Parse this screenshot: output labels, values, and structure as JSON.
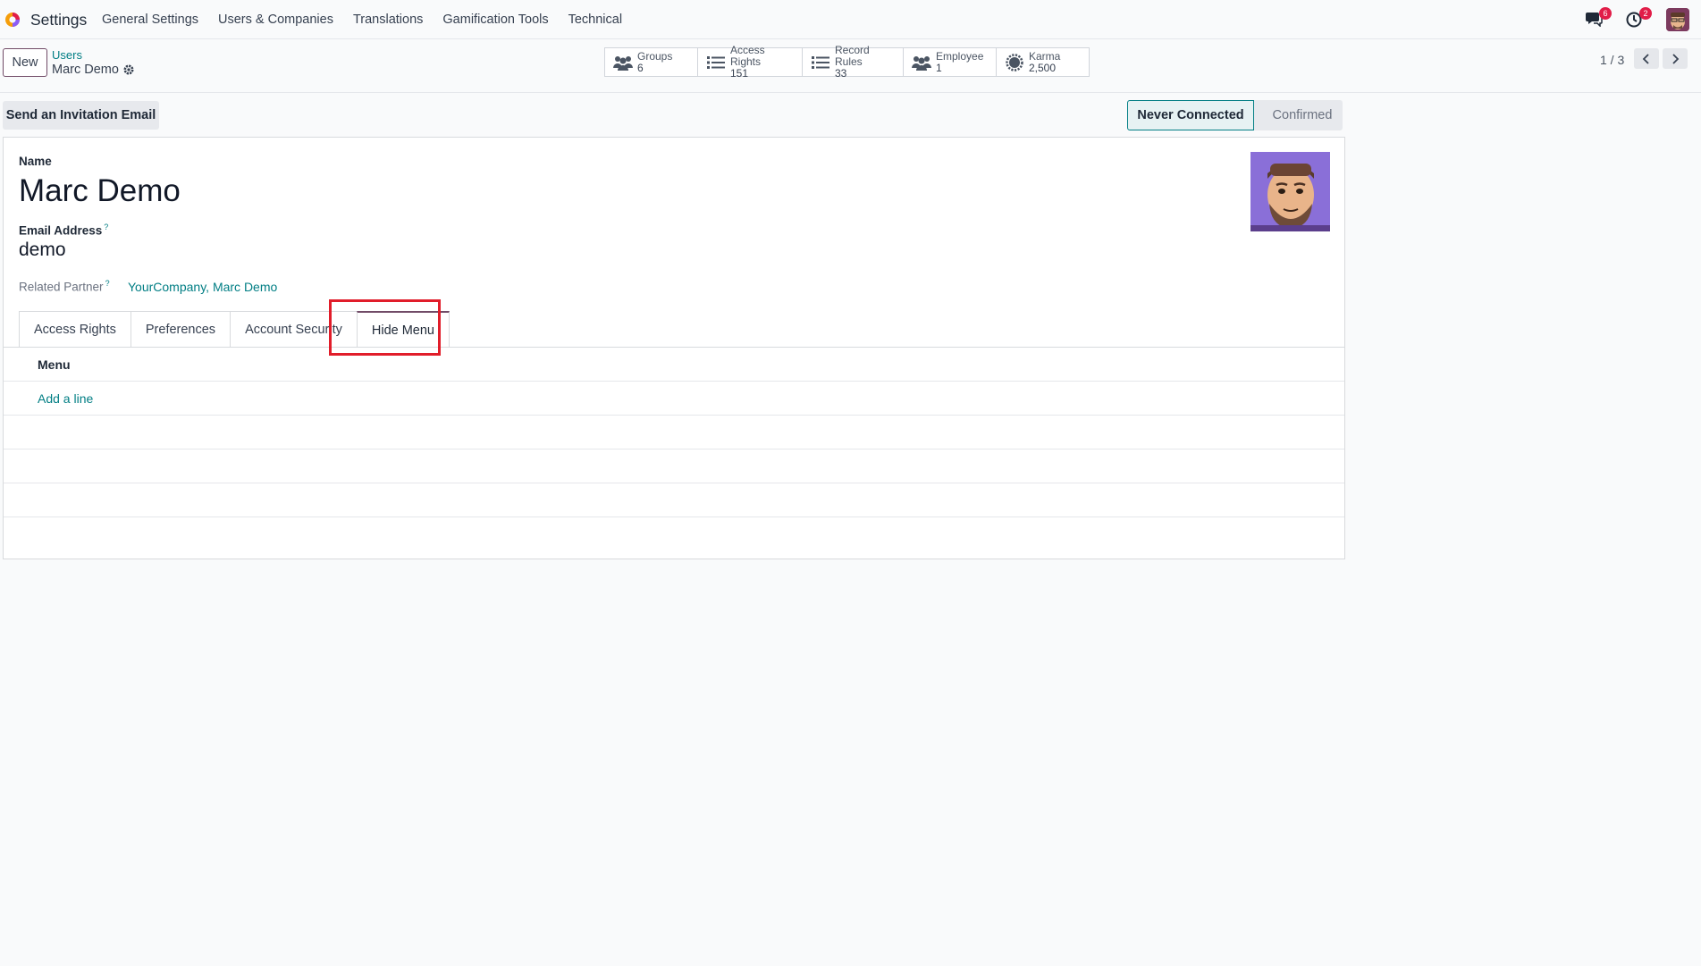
{
  "navbar": {
    "app_name": "Settings",
    "menu": [
      "General Settings",
      "Users & Companies",
      "Translations",
      "Gamification Tools",
      "Technical"
    ],
    "messages_badge": "6",
    "activities_badge": "2"
  },
  "control_panel": {
    "new_label": "New",
    "breadcrumb_parent": "Users",
    "breadcrumb_current": "Marc Demo",
    "smart_buttons": [
      {
        "label": "Groups",
        "value": "6",
        "icon": "users-icon"
      },
      {
        "label": "Access Rights",
        "value": "151",
        "icon": "list-icon"
      },
      {
        "label": "Record Rules",
        "value": "33",
        "icon": "list-icon"
      },
      {
        "label": "Employee",
        "value": "1",
        "icon": "users-icon"
      },
      {
        "label": "Karma",
        "value": "2,500",
        "icon": "badge-icon"
      }
    ],
    "pager": "1 / 3"
  },
  "actions": {
    "invite_label": "Send an Invitation Email",
    "status_steps": [
      "Never Connected",
      "Confirmed"
    ],
    "active_step": "Never Connected"
  },
  "form": {
    "name_label": "Name",
    "name_value": "Marc Demo",
    "email_label": "Email Address",
    "email_value": "demo",
    "partner_label": "Related Partner",
    "partner_value": "YourCompany, Marc Demo",
    "help_mark": "?"
  },
  "tabs": [
    "Access Rights",
    "Preferences",
    "Account Security",
    "Hide Menu"
  ],
  "active_tab": "Hide Menu",
  "hide_menu": {
    "column_header": "Menu",
    "add_line": "Add a line"
  }
}
